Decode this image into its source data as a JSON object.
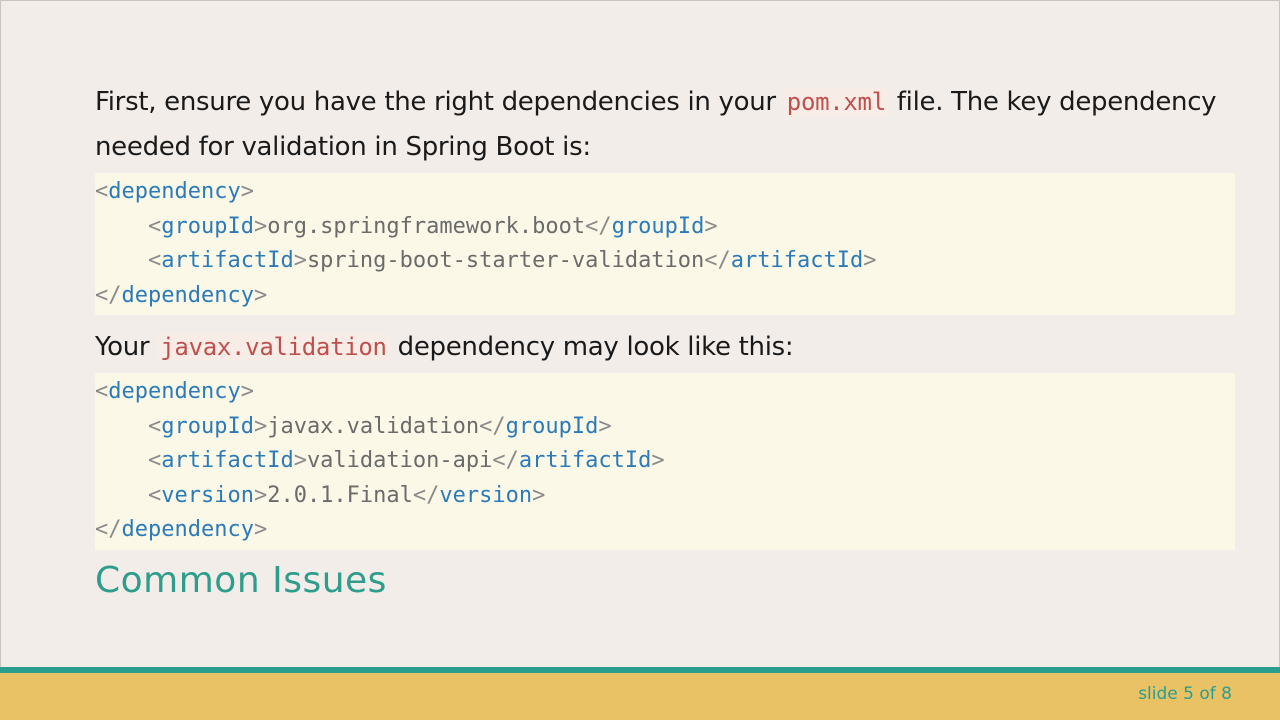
{
  "intro": {
    "text_before": "First, ensure you have the right dependencies in your ",
    "code": "pom.xml",
    "text_after": " file. The key dependency needed for validation in Spring Boot is:"
  },
  "code_block_1": {
    "lines": [
      {
        "indent": "",
        "open": "dependency",
        "value": "",
        "close": ""
      },
      {
        "indent": "    ",
        "open": "groupId",
        "value": "org.springframework.boot",
        "close": "groupId"
      },
      {
        "indent": "    ",
        "open": "artifactId",
        "value": "spring-boot-starter-validation",
        "close": "artifactId"
      },
      {
        "indent": "",
        "open": "",
        "value": "",
        "close": "dependency"
      }
    ]
  },
  "second": {
    "text_before": "Your ",
    "code": "javax.validation",
    "text_after": " dependency may look like this:"
  },
  "code_block_2": {
    "lines": [
      {
        "indent": "",
        "open": "dependency",
        "value": "",
        "close": ""
      },
      {
        "indent": "    ",
        "open": "groupId",
        "value": "javax.validation",
        "close": "groupId"
      },
      {
        "indent": "    ",
        "open": "artifactId",
        "value": "validation-api",
        "close": "artifactId"
      },
      {
        "indent": "    ",
        "open": "version",
        "value": "2.0.1.Final",
        "close": "version"
      },
      {
        "indent": "",
        "open": "",
        "value": "",
        "close": "dependency"
      }
    ]
  },
  "heading": "Common Issues",
  "footer": {
    "slide_label": "slide 5 of 8"
  },
  "colors": {
    "background": "#f3ede9",
    "code_bg": "#fcf8e8",
    "tag": "#2b7bb9",
    "inline_code": "#c0504d",
    "accent_teal": "#2a9d8f",
    "footer_gold": "#e8c265"
  }
}
